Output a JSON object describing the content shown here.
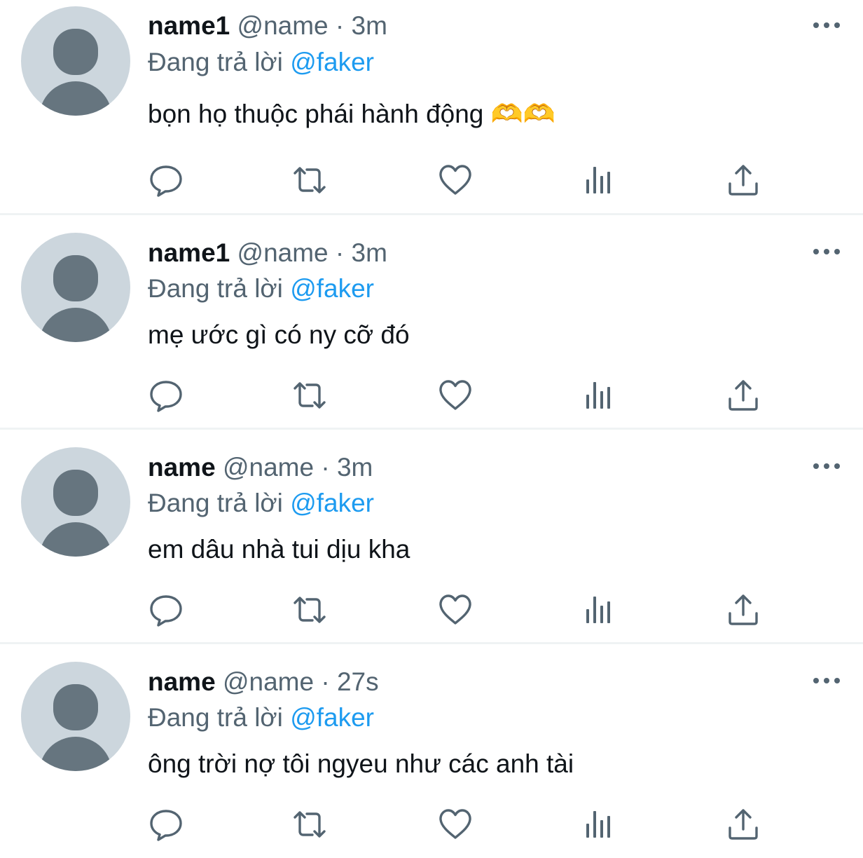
{
  "colors": {
    "text": "#0f1419",
    "secondary": "#536471",
    "accent": "#1d9bf0",
    "avatar_bg": "#ccd6dd",
    "avatar_fg": "#66757f",
    "divider": "#eff3f4"
  },
  "icons": {
    "more": "more-icon",
    "reply": "reply-icon",
    "retweet": "retweet-icon",
    "like": "heart-icon",
    "views": "views-icon",
    "share": "share-icon"
  },
  "tweets": [
    {
      "display_name": "name1",
      "handle": "@name",
      "separator": "·",
      "time": "3m",
      "reply_prefix": "Đang trả lời",
      "reply_to": "@faker",
      "text": "bọn họ thuộc phái hành động 🫶🫶"
    },
    {
      "display_name": "name1",
      "handle": "@name",
      "separator": "·",
      "time": "3m",
      "reply_prefix": "Đang trả lời",
      "reply_to": "@faker",
      "text": "mẹ ước gì có ny cỡ đó"
    },
    {
      "display_name": "name",
      "handle": "@name",
      "separator": "·",
      "time": "3m",
      "reply_prefix": "Đang trả lời",
      "reply_to": "@faker",
      "text": "em dâu nhà tui dịu kha"
    },
    {
      "display_name": "name",
      "handle": "@name",
      "separator": "·",
      "time": "27s",
      "reply_prefix": "Đang trả lời",
      "reply_to": "@faker",
      "text": "ông trời nợ tôi ngyeu như các anh tài"
    }
  ]
}
